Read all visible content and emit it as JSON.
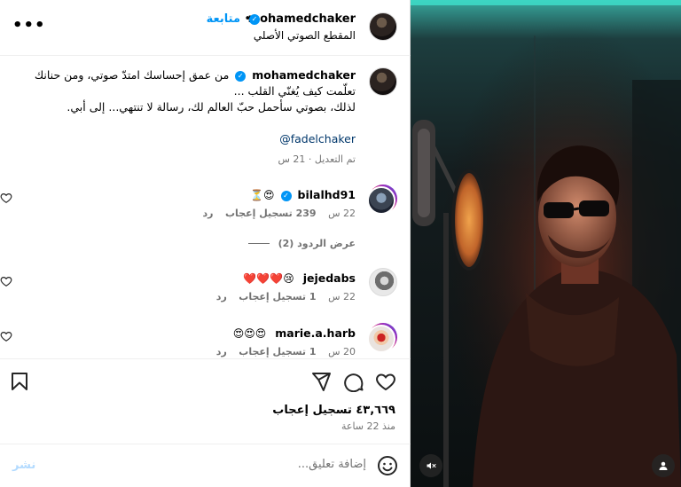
{
  "header": {
    "username": "mohamedchaker",
    "follow_label": "متابعة",
    "audio_label": "المقطع الصوتي الأصلي",
    "more_label": "•••"
  },
  "caption": {
    "username": "mohamedchaker",
    "line1": "من عمق إحساسك امتدّ صوتي، ومن حنانك",
    "line2": "تعلّمت كيف يُغنّي القلب ...",
    "line3": "لذلك، بصوتي سأحمل حبّ العالم لك، رسالة لا تنتهي... إلى أبي.",
    "mention": "@fadelchaker",
    "edited": "تم التعديل · 21 س"
  },
  "comments": [
    {
      "username": "bilalhd91",
      "verified": true,
      "text": "😍⏳",
      "time": "22 س",
      "likes": "239 تسجيل إعجاب",
      "reply": "رد"
    },
    {
      "username": "jejedabs",
      "verified": false,
      "text": "😢❤️❤️❤️",
      "time": "22 س",
      "likes": "1 تسجيل إعجاب",
      "reply": "رد"
    },
    {
      "username": "marie.a.harb",
      "verified": false,
      "text": "😍😍😍",
      "time": "20 س",
      "likes": "1 تسجيل إعجاب",
      "reply": "رد"
    }
  ],
  "view_replies_label": "عرض الردود (2)",
  "likes_count": "٤٣,٦٦٩ تسجيل إعجاب",
  "posted_time": "منذ 22 ساعة",
  "add_comment": {
    "placeholder": "إضافة تعليق...",
    "post_label": "نشر"
  },
  "colors": {
    "accent": "#0095f6",
    "secondary_text": "#737373",
    "post_disabled": "#b3dbff"
  }
}
